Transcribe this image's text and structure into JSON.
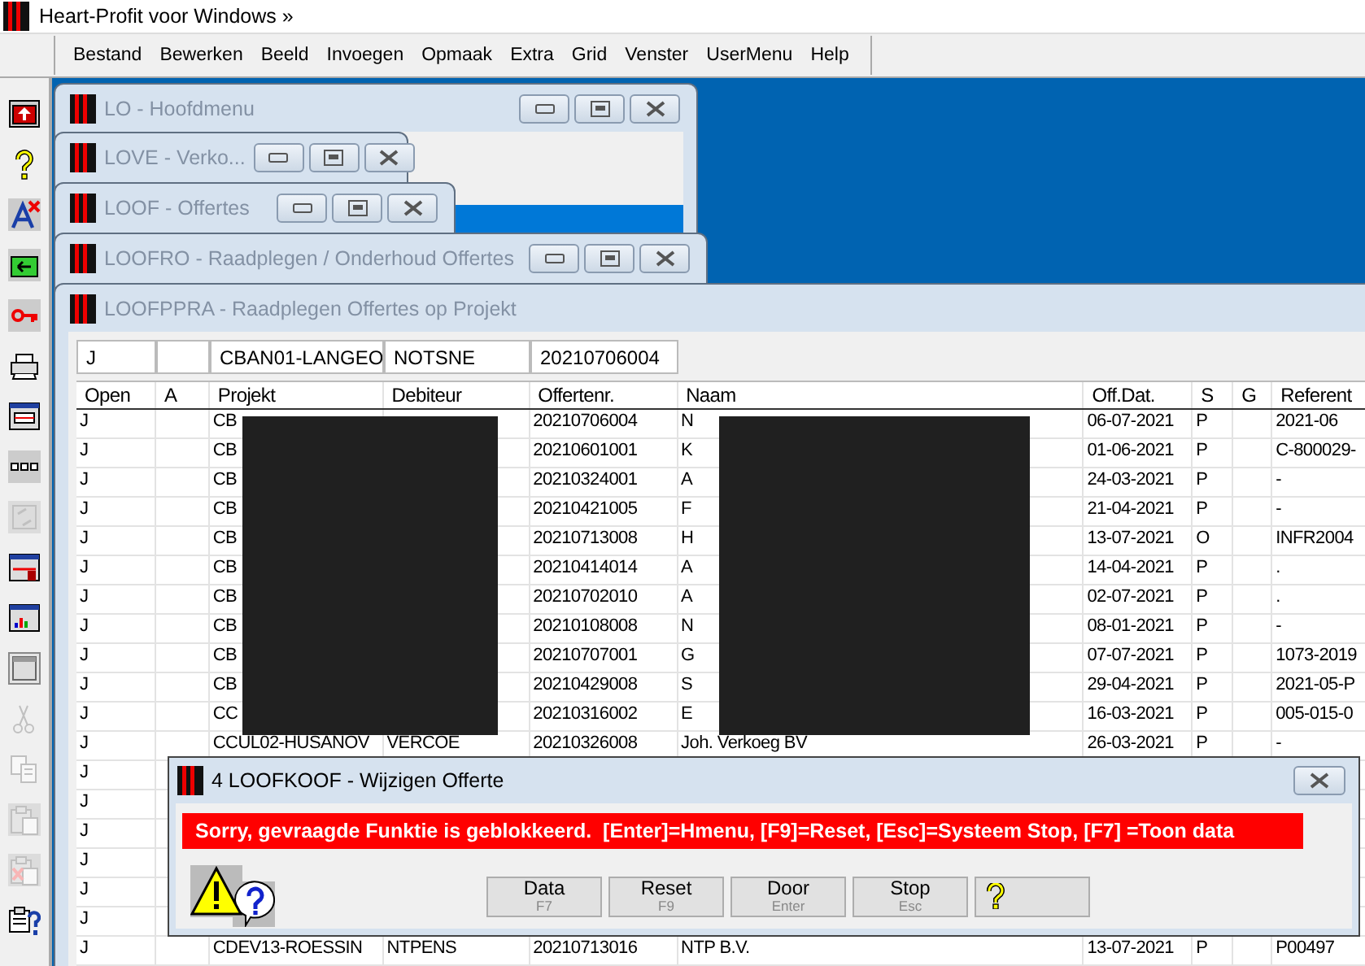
{
  "app": {
    "title": "Heart-Profit voor Windows »"
  },
  "menu": [
    "Bestand",
    "Bewerken",
    "Beeld",
    "Invoegen",
    "Opmaak",
    "Extra",
    "Grid",
    "Venster",
    "UserMenu",
    "Help"
  ],
  "toolbar": [
    {
      "disabled": false
    },
    {
      "disabled": false
    },
    {
      "disabled": false
    },
    {
      "disabled": false
    },
    {
      "disabled": false
    },
    {
      "disabled": false
    },
    {
      "disabled": false
    },
    {
      "disabled": false
    },
    {
      "disabled": true
    },
    {
      "disabled": false
    },
    {
      "disabled": false
    },
    {
      "disabled": false
    },
    {
      "disabled": true
    },
    {
      "disabled": true
    },
    {
      "disabled": true
    },
    {
      "disabled": true
    },
    {
      "disabled": false
    }
  ],
  "windows": [
    {
      "title": "LO - Hoofdmenu"
    },
    {
      "title": "LOVE - Verko..."
    },
    {
      "title": "LOOF - Offertes"
    },
    {
      "title": "LOOFRO - Raadplegen / Onderhoud Offertes"
    },
    {
      "title": "LOOFPPRA - Raadplegen Offertes op Projekt"
    }
  ],
  "filter": {
    "open": "J",
    "projekt": "CBAN01-LANGEO",
    "debiteur": "NOTSNE",
    "offertenr": "20210706004"
  },
  "table": {
    "columns": [
      "Open",
      "A",
      "Projekt",
      "Debiteur",
      "Offertenr.",
      "Naam",
      "Off.Dat.",
      "S",
      "G",
      "Referent"
    ],
    "rows": [
      [
        "J",
        null,
        "CB",
        null,
        "20210706004",
        "N",
        "06-07-2021",
        "P",
        null,
        "2021-06"
      ],
      [
        "J",
        null,
        "CB",
        null,
        "20210601001",
        "K",
        "01-06-2021",
        "P",
        null,
        "C-800029-"
      ],
      [
        "J",
        null,
        "CB",
        null,
        "20210324001",
        "A",
        "24-03-2021",
        "P",
        null,
        "-"
      ],
      [
        "J",
        null,
        "CB",
        null,
        "20210421005",
        "F",
        "21-04-2021",
        "P",
        null,
        "-"
      ],
      [
        "J",
        null,
        "CB",
        null,
        "20210713008",
        "H",
        "13-07-2021",
        "O",
        null,
        "INFR2004"
      ],
      [
        "J",
        null,
        "CB",
        null,
        "20210414014",
        "A",
        "14-04-2021",
        "P",
        null,
        "."
      ],
      [
        "J",
        null,
        "CB",
        null,
        "20210702010",
        "A",
        "02-07-2021",
        "P",
        null,
        "."
      ],
      [
        "J",
        null,
        "CB",
        null,
        "20210108008",
        "N",
        "08-01-2021",
        "P",
        null,
        "-"
      ],
      [
        "J",
        null,
        "CB",
        null,
        "20210707001",
        "G",
        "07-07-2021",
        "P",
        null,
        "1073-2019"
      ],
      [
        "J",
        null,
        "CB",
        null,
        "20210429008",
        "S",
        "29-04-2021",
        "P",
        null,
        "2021-05-P"
      ],
      [
        "J",
        null,
        "CC",
        null,
        "20210316002",
        "E",
        "16-03-2021",
        "P",
        null,
        "005-015-0"
      ],
      [
        "J",
        null,
        "CCUL02-HUSANOV",
        "VERCOE",
        "20210326008",
        "Joh. Verkoeg BV",
        "26-03-2021",
        "P",
        null,
        "-"
      ],
      [
        "J",
        null,
        null,
        null,
        null,
        null,
        null,
        null,
        null,
        null
      ],
      [
        "J",
        null,
        null,
        null,
        null,
        null,
        null,
        null,
        null,
        null
      ],
      [
        "J",
        null,
        null,
        null,
        null,
        null,
        null,
        null,
        null,
        null
      ],
      [
        "J",
        null,
        null,
        null,
        null,
        null,
        null,
        null,
        null,
        null
      ],
      [
        "J",
        null,
        null,
        null,
        null,
        null,
        null,
        null,
        null,
        null
      ],
      [
        "J",
        null,
        null,
        null,
        null,
        null,
        null,
        null,
        null,
        null
      ],
      [
        "J",
        null,
        "CDEV13-ROESSIN",
        "NTPENS",
        "20210713016",
        "NTP B.V.",
        "13-07-2021",
        "P",
        null,
        "P00497"
      ]
    ]
  },
  "dialog": {
    "title": "4 LOOFKOOF - Wijzigen Offerte",
    "message": "Sorry, gevraagde Funktie is geblokkeerd.  [Enter]=Hmenu, [F9]=Reset, [Esc]=Systeem Stop, [F7] =Toon data",
    "buttons": [
      {
        "kind": "text",
        "label": "Data",
        "key": "F7"
      },
      {
        "kind": "text",
        "label": "Reset",
        "key": "F9"
      },
      {
        "kind": "text",
        "label": "Door",
        "key": "Enter"
      },
      {
        "kind": "text",
        "label": "Stop",
        "key": "Esc"
      },
      {
        "kind": "help"
      }
    ]
  }
}
